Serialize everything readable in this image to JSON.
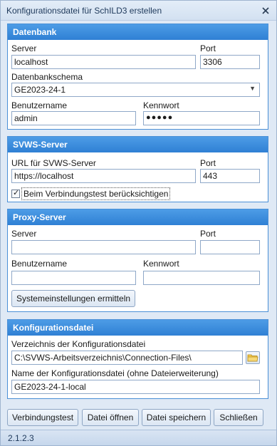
{
  "window": {
    "title": "Konfigurationsdatei für SchILD3 erstellen",
    "icon": "close-icon"
  },
  "datenbank": {
    "header": "Datenbank",
    "server_label": "Server",
    "server_value": "localhost",
    "port_label": "Port",
    "port_value": "3306",
    "schema_label": "Datenbankschema",
    "schema_value": "GE2023-24-1",
    "user_label": "Benutzername",
    "user_value": "admin",
    "password_label": "Kennwort",
    "password_value": "●●●●●"
  },
  "svws": {
    "header": "SVWS-Server",
    "url_label": "URL für SVWS-Server",
    "url_value": "https://localhost",
    "port_label": "Port",
    "port_value": "443",
    "checkbox_label": "Beim Verbindungstest berücksichtigen",
    "checkbox_checked": true
  },
  "proxy": {
    "header": "Proxy-Server",
    "server_label": "Server",
    "server_value": "",
    "port_label": "Port",
    "port_value": "",
    "user_label": "Benutzername",
    "user_value": "",
    "password_label": "Kennwort",
    "password_value": "",
    "system_button": "Systemeinstellungen ermitteln"
  },
  "config": {
    "header": "Konfigurationsdatei",
    "dir_label": "Verzeichnis der Konfigurationsdatei",
    "dir_value": "C:\\SVWS-Arbeitsverzeichnis\\Connection-Files\\",
    "name_label": "Name der Konfigurationsdatei (ohne Dateierweiterung)",
    "name_value": "GE2023-24-1-local"
  },
  "buttons": {
    "test": "Verbindungstest",
    "open": "Datei öffnen",
    "save": "Datei speichern",
    "close": "Schließen"
  },
  "status": {
    "version": "2.1.2.3"
  },
  "colors": {
    "group_header": "#3a8ad9",
    "window_bg": "#dfe9f5"
  }
}
